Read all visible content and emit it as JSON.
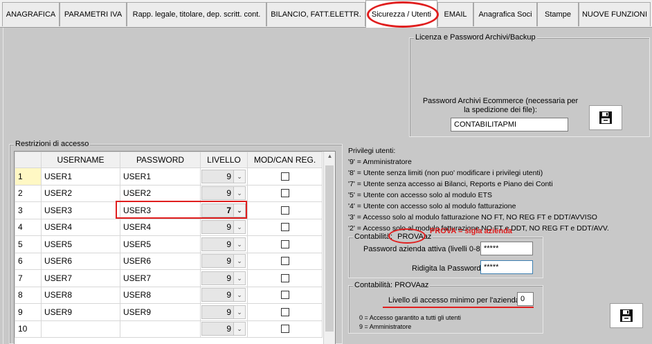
{
  "tabs": [
    {
      "label": "ANAGRAFICA",
      "active": false
    },
    {
      "label": "PARAMETRI IVA",
      "active": false
    },
    {
      "label": "Rapp. legale, titolare, dep. scritt. cont.",
      "active": false
    },
    {
      "label": "BILANCIO, FATT.ELETTR.",
      "active": false
    },
    {
      "label": "Sicurezza / Utenti",
      "active": true
    },
    {
      "label": "EMAIL",
      "active": false
    },
    {
      "label": "Anagrafica Soci",
      "active": false
    },
    {
      "label": "Stampe",
      "active": false
    },
    {
      "label": "NUOVE FUNZIONI",
      "active": false
    }
  ],
  "license": {
    "legend": "Licenza e Password Archivi/Backup",
    "ecommerce_label": "Password Archivi Ecommerce (necessaria per la spedizione dei file):",
    "ecommerce_value": "CONTABILITAPMI"
  },
  "restrictions": {
    "legend": "Restrizioni di accesso",
    "columns": [
      "",
      "USERNAME",
      "PASSWORD",
      "LIVELLO",
      "MOD/CAN REG."
    ],
    "rows": [
      {
        "n": "1",
        "username": "USER1",
        "password": "USER1",
        "level": "9",
        "mod": false
      },
      {
        "n": "2",
        "username": "USER2",
        "password": "USER2",
        "level": "9",
        "mod": false
      },
      {
        "n": "3",
        "username": "USER3",
        "password": "USER3",
        "level": "7",
        "mod": false
      },
      {
        "n": "4",
        "username": "USER4",
        "password": "USER4",
        "level": "9",
        "mod": false
      },
      {
        "n": "5",
        "username": "USER5",
        "password": "USER5",
        "level": "9",
        "mod": false
      },
      {
        "n": "6",
        "username": "USER6",
        "password": "USER6",
        "level": "9",
        "mod": false
      },
      {
        "n": "7",
        "username": "USER7",
        "password": "USER7",
        "level": "9",
        "mod": false
      },
      {
        "n": "8",
        "username": "USER8",
        "password": "USER8",
        "level": "9",
        "mod": false
      },
      {
        "n": "9",
        "username": "USER9",
        "password": "USER9",
        "level": "9",
        "mod": false
      },
      {
        "n": "10",
        "username": "",
        "password": "",
        "level": "9",
        "mod": false
      }
    ]
  },
  "privileges": {
    "title": "Privilegi utenti:",
    "lines": [
      "'9' = Amministratore",
      "'8' = Utente senza limiti (non puo' modificare i privilegi utenti)",
      "'7' = Utente senza accesso ai Bilanci,  Reports e Piano dei Conti",
      "'5' = Utente con accesso solo al modulo ETS",
      "'4' = Utente con accesso solo al modulo fatturazione",
      "'3' = Accesso solo al modulo fatturazione NO FT, NO REG FT e DDT/AVVISO",
      "'2' = Accesso solo al modulo fatturazione NO FT e DDT, NO REG FT e DDT/AVV."
    ]
  },
  "company_pw": {
    "legend": "Contabilità:",
    "company": "PROVAaz",
    "note": "PROVA = sigla azienda",
    "active_label": "Password azienda attiva (livelli 0-8):",
    "active_value": "*****",
    "repeat_label": "Ridigita la Password:",
    "repeat_value": "*****"
  },
  "company_level": {
    "legend": "Contabilità:  PROVAaz",
    "min_label": "Livello di accesso minimo per l'azienda:",
    "min_value": "0",
    "note1": "0 = Accesso garantito a tutti gli utenti",
    "note2": "9 = Amministratore"
  },
  "icons": {
    "save": "floppy-disk-icon",
    "scroll_up": "chevron-up-icon",
    "dropdown": "chevron-down-icon"
  },
  "colors": {
    "highlight": "#e01e1e",
    "selected_row": "#fff8c4"
  }
}
